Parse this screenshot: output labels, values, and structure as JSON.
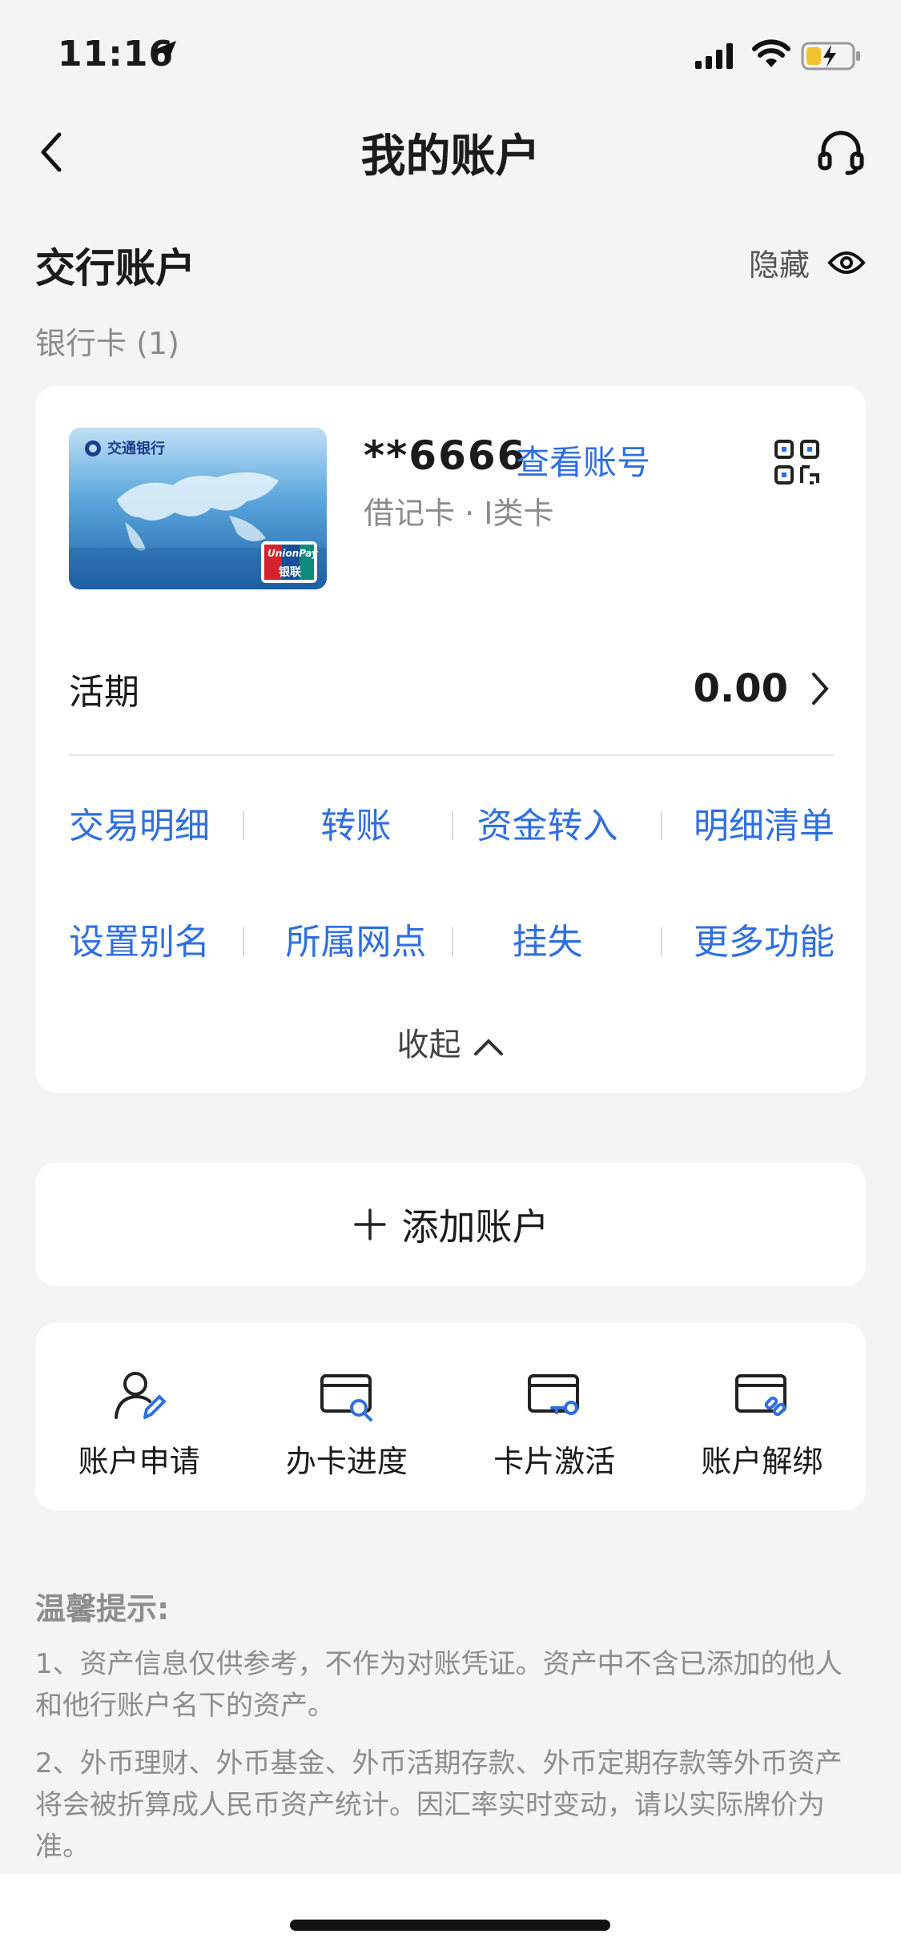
{
  "status_bar": {
    "time": "11:16",
    "icons": [
      "location-arrow-icon",
      "cellular-signal-icon",
      "wifi-icon",
      "battery-charging-icon"
    ]
  },
  "nav": {
    "title": "我的账户",
    "back_icon": "chevron-left-icon",
    "service_icon": "headset-icon"
  },
  "section": {
    "title": "交行账户",
    "hide_label": "隐藏",
    "bankcard_count": "银行卡 (1)"
  },
  "card": {
    "number": "**6666",
    "view_account_label": "查看账号",
    "type": "借记卡 · I类卡",
    "current_label": "活期",
    "current_balance": "0.00",
    "bank_logo_text": "交通银行",
    "unionpay_text": "UnionPay",
    "unionpay_cn": "银联",
    "actions_row1": [
      "交易明细",
      "转账",
      "资金转入",
      "明细清单"
    ],
    "actions_row2": [
      "设置别名",
      "所属网点",
      "挂失",
      "更多功能"
    ],
    "collapse_label": "收起"
  },
  "add_account": {
    "label": "添加账户"
  },
  "services": [
    {
      "label": "账户申请",
      "icon": "user-edit-icon"
    },
    {
      "label": "办卡进度",
      "icon": "card-search-icon"
    },
    {
      "label": "卡片激活",
      "icon": "card-key-icon"
    },
    {
      "label": "账户解绑",
      "icon": "card-unlink-icon"
    }
  ],
  "tips": {
    "title": "温馨提示:",
    "items": [
      "1、资产信息仅供参考，不作为对账凭证。资产中不含已添加的他人和他行账户名下的资产。",
      "2、外币理财、外币基金、外币活期存款、外币定期存款等外币资产将会被折算成人民币资产统计。因汇率实时变动，请以实际牌价为准。"
    ]
  },
  "colors": {
    "accent": "#2f6fe0",
    "background": "#f4f4f4",
    "muted_text": "#8d8d8d"
  }
}
